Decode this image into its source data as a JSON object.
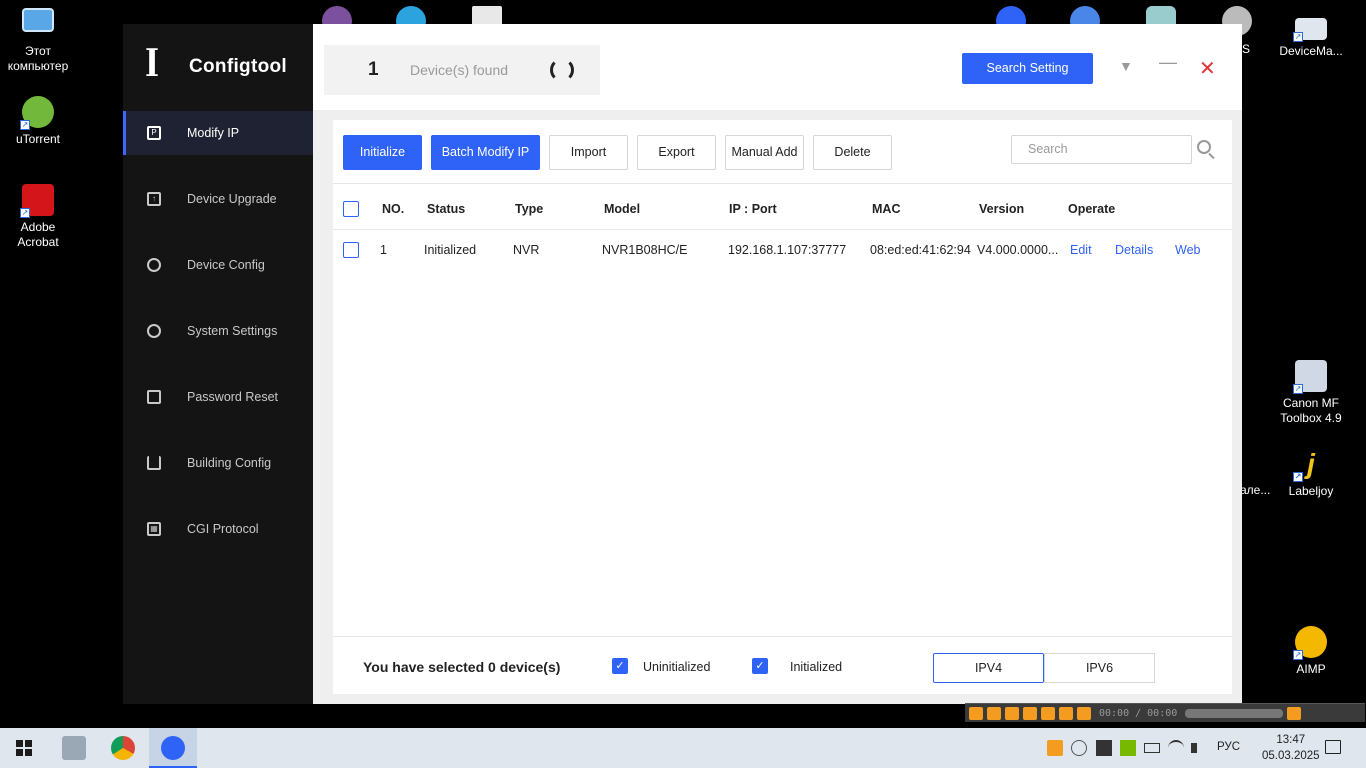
{
  "desktop": {
    "left_icons": [
      {
        "label": "Этот компьютер",
        "name": "this-pc"
      },
      {
        "label": "uTorrent",
        "name": "utorrent"
      },
      {
        "label": "Adobe Acrobat",
        "name": "adobe-acrobat"
      }
    ],
    "right_icons": [
      {
        "label": "DeviceMa...",
        "name": "devicemanager"
      },
      {
        "label": "Canon MF Toolbox 4.9",
        "name": "canon-mf-toolbox"
      },
      {
        "label": "Labeljoy",
        "name": "labeljoy"
      },
      {
        "label": "AIMP",
        "name": "aimp"
      }
    ],
    "partial_labels": {
      "s_label": "S",
      "ale_label": "але..."
    }
  },
  "app": {
    "brand": "Configtool",
    "nav": [
      {
        "label": "Modify IP",
        "icon": "ip-icon",
        "active": true
      },
      {
        "label": "Device Upgrade",
        "icon": "upgrade-icon",
        "active": false
      },
      {
        "label": "Device Config",
        "icon": "config-icon",
        "active": false
      },
      {
        "label": "System Settings",
        "icon": "settings-icon",
        "active": false
      },
      {
        "label": "Password Reset",
        "icon": "lock-icon",
        "active": false
      },
      {
        "label": "Building Config",
        "icon": "building-icon",
        "active": false
      },
      {
        "label": "CGI Protocol",
        "icon": "grid-icon",
        "active": false
      }
    ],
    "header": {
      "device_count": "1",
      "device_found_label": "Device(s) found",
      "search_setting_label": "Search Setting"
    },
    "toolbar": {
      "initialize": "Initialize",
      "batch_modify_ip": "Batch Modify IP",
      "import": "Import",
      "export": "Export",
      "manual_add": "Manual Add",
      "delete": "Delete",
      "search_placeholder": "Search"
    },
    "table": {
      "headers": [
        "NO.",
        "Status",
        "Type",
        "Model",
        "IP : Port",
        "MAC",
        "Version",
        "Operate"
      ],
      "rows": [
        {
          "no": "1",
          "status": "Initialized",
          "type": "NVR",
          "model": "NVR1B08HC/E",
          "ip_port": "192.168.1.107:37777",
          "mac": "08:ed:ed:41:62:94",
          "version": "V4.000.0000...",
          "edit": "Edit",
          "details": "Details",
          "web": "Web"
        }
      ]
    },
    "footer": {
      "selected_text": "You have selected 0  device(s)",
      "uninitialized_label": "Uninitialized",
      "initialized_label": "Initialized",
      "ipv4_label": "IPV4",
      "ipv6_label": "IPV6"
    }
  },
  "player": {
    "time": "00:00 / 00:00",
    "volume": 0.35
  },
  "taskbar": {
    "lang": "РУС",
    "time": "13:47",
    "date": "05.03.2025"
  },
  "colors": {
    "accent": "#2f62f7",
    "sidebar_bg": "#141414",
    "close_red": "#e0333a"
  }
}
